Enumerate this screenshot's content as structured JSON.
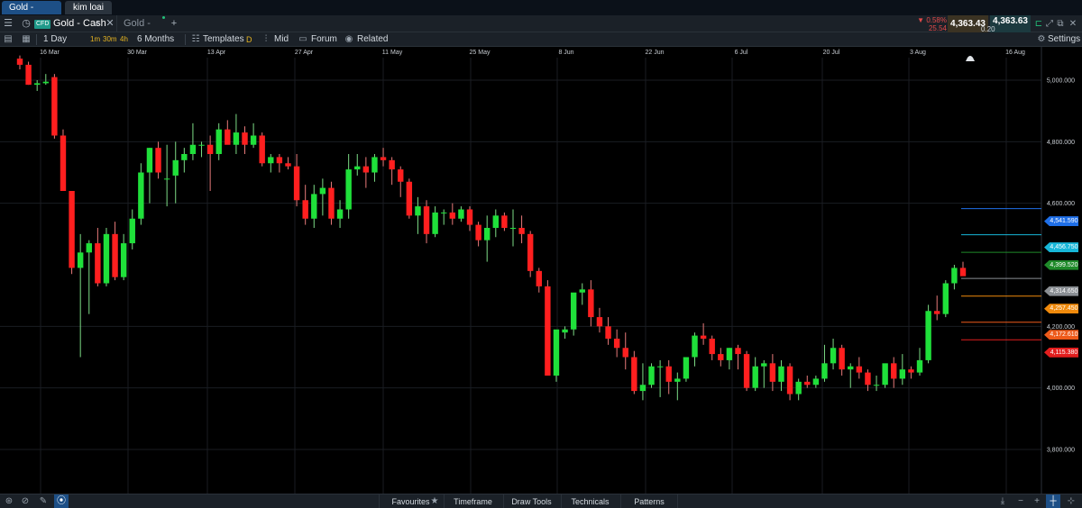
{
  "workspace_tabs": [
    "Gold - Cash",
    "kim loai"
  ],
  "instrument": {
    "badge": "CFD",
    "title": "Gold - Cash",
    "second_tab": "Gold - Cash"
  },
  "quote": {
    "change_pct": "▼ 0.58%",
    "change_abs": "25.54",
    "bid": "4,363.43",
    "ask": "4,363.63",
    "spread": "0.20"
  },
  "toolbar": {
    "interval": "1 Day",
    "timeframes": [
      "1m",
      "30m",
      "4h"
    ],
    "range": "6 Months",
    "templates_label": "Templates",
    "d_label": "D",
    "mid_label": "Mid",
    "forum_label": "Forum",
    "related_label": "Related",
    "settings_label": "Settings"
  },
  "icons": {
    "menu": "hamburger-icon",
    "clock": "clock-icon",
    "search": "search-icon",
    "close": "close-icon",
    "gear": "gear-icon",
    "pencil": "pencil-icon"
  },
  "colors": {
    "up": "#1fe03a",
    "down": "#ff1f1f",
    "grid": "#1a1d22",
    "axis_text": "#c9ced4"
  },
  "chart_data": {
    "type": "candlestick",
    "date_labels": [
      "16 Mar",
      "30 Mar",
      "13 Apr",
      "27 Apr",
      "11 May",
      "25 May",
      "8 Jun",
      "22 Jun",
      "6 Jul",
      "20 Jul",
      "3 Aug",
      "16 Aug"
    ],
    "price_labels": [
      "5,000.000",
      "4,800.000",
      "4,600.000",
      "4,200.000",
      "4,000.000",
      "3,800.000"
    ],
    "ylim": [
      3700,
      5080
    ],
    "candles": [
      [
        5070,
        5080,
        5035,
        5050
      ],
      [
        5050,
        5060,
        4985,
        4985
      ],
      [
        4985,
        5000,
        4965,
        4990
      ],
      [
        4990,
        5020,
        4985,
        4995
      ],
      [
        5010,
        5020,
        4810,
        4820
      ],
      [
        4820,
        4840,
        4640,
        4640
      ],
      [
        4640,
        4640,
        4370,
        4390
      ],
      [
        4390,
        4500,
        4100,
        4440
      ],
      [
        4440,
        4480,
        4240,
        4470
      ],
      [
        4470,
        4520,
        4330,
        4340
      ],
      [
        4340,
        4520,
        4330,
        4500
      ],
      [
        4500,
        4540,
        4350,
        4360
      ],
      [
        4360,
        4500,
        4350,
        4470
      ],
      [
        4470,
        4580,
        4450,
        4550
      ],
      [
        4550,
        4730,
        4530,
        4700
      ],
      [
        4700,
        4780,
        4600,
        4780
      ],
      [
        4780,
        4800,
        4680,
        4700
      ],
      [
        4680,
        4790,
        4590,
        4680
      ],
      [
        4690,
        4800,
        4600,
        4740
      ],
      [
        4740,
        4780,
        4700,
        4760
      ],
      [
        4760,
        4860,
        4740,
        4790
      ],
      [
        4790,
        4800,
        4750,
        4790
      ],
      [
        4790,
        4820,
        4640,
        4760
      ],
      [
        4760,
        4860,
        4740,
        4840
      ],
      [
        4840,
        4870,
        4800,
        4790
      ],
      [
        4790,
        4890,
        4760,
        4830
      ],
      [
        4830,
        4850,
        4760,
        4790
      ],
      [
        4790,
        4860,
        4780,
        4820
      ],
      [
        4820,
        4830,
        4720,
        4730
      ],
      [
        4730,
        4760,
        4700,
        4750
      ],
      [
        4750,
        4760,
        4700,
        4730
      ],
      [
        4730,
        4750,
        4710,
        4720
      ],
      [
        4720,
        4760,
        4590,
        4610
      ],
      [
        4610,
        4660,
        4530,
        4550
      ],
      [
        4550,
        4660,
        4520,
        4630
      ],
      [
        4630,
        4680,
        4560,
        4650
      ],
      [
        4650,
        4670,
        4530,
        4550
      ],
      [
        4550,
        4610,
        4520,
        4580
      ],
      [
        4580,
        4760,
        4550,
        4710
      ],
      [
        4710,
        4760,
        4690,
        4720
      ],
      [
        4720,
        4750,
        4650,
        4700
      ],
      [
        4700,
        4760,
        4670,
        4750
      ],
      [
        4750,
        4780,
        4720,
        4740
      ],
      [
        4740,
        4750,
        4660,
        4710
      ],
      [
        4710,
        4720,
        4620,
        4670
      ],
      [
        4670,
        4680,
        4550,
        4560
      ],
      [
        4560,
        4620,
        4500,
        4590
      ],
      [
        4590,
        4610,
        4470,
        4500
      ],
      [
        4500,
        4590,
        4490,
        4570
      ],
      [
        4570,
        4580,
        4530,
        4570
      ],
      [
        4570,
        4600,
        4530,
        4550
      ],
      [
        4550,
        4590,
        4540,
        4580
      ],
      [
        4580,
        4590,
        4510,
        4530
      ],
      [
        4530,
        4540,
        4460,
        4480
      ],
      [
        4480,
        4560,
        4410,
        4520
      ],
      [
        4520,
        4580,
        4490,
        4560
      ],
      [
        4560,
        4570,
        4510,
        4520
      ],
      [
        4520,
        4580,
        4460,
        4520
      ],
      [
        4520,
        4560,
        4470,
        4500
      ],
      [
        4500,
        4510,
        4360,
        4380
      ],
      [
        4380,
        4390,
        4310,
        4330
      ],
      [
        4330,
        4350,
        4160,
        4040
      ],
      [
        4040,
        4180,
        4020,
        4190
      ],
      [
        4180,
        4200,
        4160,
        4190
      ],
      [
        4190,
        4280,
        4170,
        4310
      ],
      [
        4310,
        4340,
        4270,
        4320
      ],
      [
        4320,
        4350,
        4200,
        4230
      ],
      [
        4230,
        4260,
        4180,
        4200
      ],
      [
        4200,
        4230,
        4140,
        4160
      ],
      [
        4160,
        4190,
        4100,
        4130
      ],
      [
        4130,
        4180,
        4060,
        4100
      ],
      [
        4100,
        4120,
        3980,
        3990
      ],
      [
        3990,
        4080,
        3960,
        4010
      ],
      [
        4010,
        4080,
        4000,
        4070
      ],
      [
        4070,
        4090,
        3970,
        4070
      ],
      [
        4070,
        4090,
        3980,
        4020
      ],
      [
        4020,
        4050,
        3960,
        4030
      ],
      [
        4030,
        4100,
        4020,
        4100
      ],
      [
        4100,
        4180,
        4070,
        4170
      ],
      [
        4170,
        4210,
        4140,
        4160
      ],
      [
        4160,
        4170,
        4090,
        4110
      ],
      [
        4110,
        4130,
        4070,
        4090
      ],
      [
        4090,
        4130,
        4060,
        4130
      ],
      [
        4130,
        4140,
        4060,
        4110
      ],
      [
        4110,
        4120,
        3990,
        4000
      ],
      [
        4000,
        4100,
        3990,
        4070
      ],
      [
        4070,
        4090,
        4000,
        4080
      ],
      [
        4080,
        4110,
        3990,
        4020
      ],
      [
        4020,
        4090,
        3990,
        4070
      ],
      [
        4070,
        4080,
        3960,
        3980
      ],
      [
        3980,
        4030,
        3960,
        4020
      ],
      [
        4020,
        4040,
        4000,
        4010
      ],
      [
        4010,
        4040,
        4000,
        4030
      ],
      [
        4030,
        4140,
        4020,
        4080
      ],
      [
        4080,
        4160,
        4060,
        4130
      ],
      [
        4130,
        4140,
        4040,
        4060
      ],
      [
        4060,
        4080,
        4000,
        4070
      ],
      [
        4070,
        4100,
        4030,
        4050
      ],
      [
        4050,
        4060,
        3990,
        4010
      ],
      [
        4010,
        4040,
        3990,
        4010
      ],
      [
        4010,
        4060,
        4000,
        4080
      ],
      [
        4080,
        4100,
        4000,
        4030
      ],
      [
        4030,
        4110,
        4010,
        4060
      ],
      [
        4060,
        4070,
        4030,
        4050
      ],
      [
        4050,
        4130,
        4040,
        4090
      ],
      [
        4090,
        4270,
        4080,
        4250
      ],
      [
        4250,
        4300,
        4220,
        4240
      ],
      [
        4240,
        4350,
        4230,
        4340
      ],
      [
        4340,
        4400,
        4320,
        4390
      ],
      [
        4390,
        4410,
        4370,
        4363
      ]
    ]
  },
  "price_tags": [
    {
      "label": "4,541.590",
      "value": 4541.59,
      "color": "#1f6fe8"
    },
    {
      "label": "4,456.750",
      "value": 4456.75,
      "color": "#17b6d8"
    },
    {
      "label": "4,399.520",
      "value": 4399.52,
      "color": "#1f8a2a"
    },
    {
      "label": "4,314.650",
      "value": 4314.65,
      "color": "#8a8e93"
    },
    {
      "label": "4,257.450",
      "value": 4257.45,
      "color": "#f08a0c"
    },
    {
      "label": "4,172.610",
      "value": 4172.61,
      "color": "#ee5a1a"
    },
    {
      "label": "4,115.380",
      "value": 4115.38,
      "color": "#e21e1e"
    }
  ],
  "bottom_bar": {
    "favourites": "Favourites",
    "timeframe": "Timeframe",
    "draw_tools": "Draw Tools",
    "technicals": "Technicals",
    "patterns": "Patterns"
  }
}
